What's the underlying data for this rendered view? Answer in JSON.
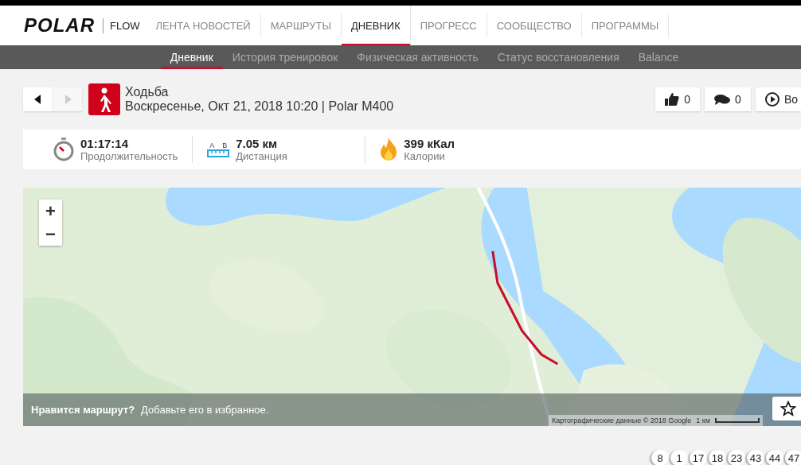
{
  "header": {
    "logo": "POLAR",
    "product": "FLOW",
    "nav": [
      {
        "label": "ЛЕНТА НОВОСТЕЙ",
        "selected": false
      },
      {
        "label": "МАРШРУТЫ",
        "selected": false
      },
      {
        "label": "ДНЕВНИК",
        "selected": true
      },
      {
        "label": "ПРОГРЕСС",
        "selected": false
      },
      {
        "label": "СООБЩЕСТВО",
        "selected": false
      },
      {
        "label": "ПРОГРАММЫ",
        "selected": false
      }
    ]
  },
  "subnav": [
    {
      "label": "Дневник",
      "selected": true
    },
    {
      "label": "История тренировок",
      "selected": false
    },
    {
      "label": "Физическая активность",
      "selected": false
    },
    {
      "label": "Статус восстановления",
      "selected": false
    },
    {
      "label": "Balance",
      "selected": false
    }
  ],
  "session": {
    "sport": "Ходьба",
    "details": "Воскресенье, Окт 21, 2018 10:20 | Polar M400",
    "likes": "0",
    "comments": "0",
    "replay": "Во"
  },
  "stats": [
    {
      "kind": "duration",
      "value": "01:17:14",
      "label": "Продолжительность"
    },
    {
      "kind": "distance",
      "value": "7.05 км",
      "label": "Дистанция",
      "marks": [
        "A",
        "B"
      ]
    },
    {
      "kind": "calories",
      "value": "399 кКал",
      "label": "Калории"
    }
  ],
  "map": {
    "zoom_in": "+",
    "zoom_out": "−",
    "prompt_bold": "Нравится маршрут?",
    "prompt": "Добавьте его в избранное.",
    "attribution": "Картографические данные © 2018 Google",
    "scale": "1 км"
  },
  "laps": [
    "8",
    "1",
    "17",
    "18",
    "23",
    "43",
    "44",
    "47"
  ]
}
